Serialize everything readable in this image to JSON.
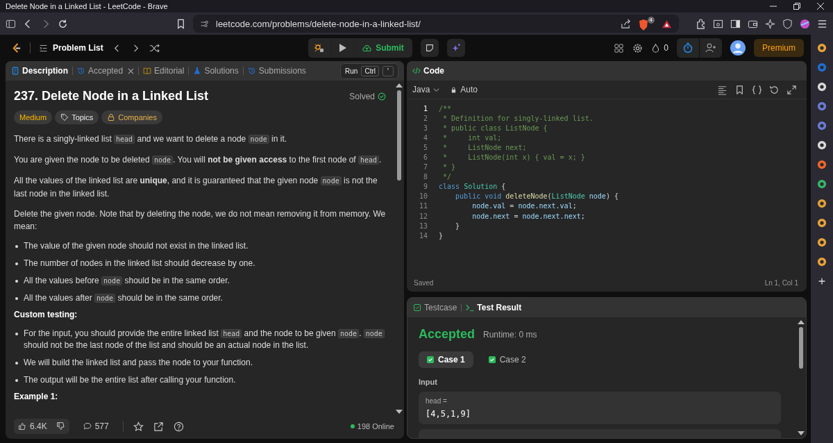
{
  "browser": {
    "title": "Delete Node in a Linked List - LeetCode - Brave",
    "url": "leetcode.com/problems/delete-node-in-a-linked-list/",
    "shields_count": "4"
  },
  "nav": {
    "problem_list": "Problem List",
    "submit": "Submit",
    "streak": "0",
    "premium": "Premium"
  },
  "run_hint": {
    "label": "Run",
    "keys": [
      "Ctrl",
      "'"
    ]
  },
  "description": {
    "tabs": [
      {
        "label": "Description",
        "kind": "description",
        "selected": true,
        "closable": false
      },
      {
        "label": "Accepted",
        "kind": "history",
        "selected": false,
        "closable": true
      },
      {
        "label": "Editorial",
        "kind": "book",
        "selected": false,
        "closable": false
      },
      {
        "label": "Solutions",
        "kind": "flask",
        "selected": false,
        "closable": false
      },
      {
        "label": "Submissions",
        "kind": "history",
        "selected": false,
        "closable": false
      }
    ],
    "title": "237. Delete Node in a Linked List",
    "status": "Solved",
    "tags": [
      {
        "label": "Medium",
        "kind": "difficulty"
      },
      {
        "label": "Topics",
        "kind": "topics"
      },
      {
        "label": "Companies",
        "kind": "companies"
      }
    ],
    "blocks": [
      {
        "kind": "paragraph",
        "parts": [
          {
            "text": "There is a singly-linked list "
          },
          {
            "code": "head"
          },
          {
            "text": " and we want to delete a node "
          },
          {
            "code": "node"
          },
          {
            "text": " in it."
          }
        ]
      },
      {
        "kind": "paragraph",
        "parts": [
          {
            "text": "You are given the node to be deleted "
          },
          {
            "code": "node"
          },
          {
            "text": ". You will **not be given access** to the first node of "
          },
          {
            "code": "head"
          },
          {
            "text": "."
          }
        ]
      },
      {
        "kind": "paragraph",
        "parts": [
          {
            "text": "All the values of the linked list are **unique**, and it is guaranteed that the given node "
          },
          {
            "code": "node"
          },
          {
            "text": " is not the last node in the linked list."
          }
        ]
      },
      {
        "kind": "paragraph",
        "parts": [
          {
            "text": "Delete the given node. Note that by deleting the node, we do not mean removing it from memory. We mean:"
          }
        ]
      },
      {
        "kind": "bullet",
        "parts": [
          {
            "text": "The value of the given node should not exist in the linked list."
          }
        ]
      },
      {
        "kind": "bullet",
        "parts": [
          {
            "text": "The number of nodes in the linked list should decrease by one."
          }
        ]
      },
      {
        "kind": "bullet",
        "parts": [
          {
            "text": "All the values before "
          },
          {
            "code": "node"
          },
          {
            "text": " should be in the same order."
          }
        ]
      },
      {
        "kind": "bullet",
        "parts": [
          {
            "text": "All the values after "
          },
          {
            "code": "node"
          },
          {
            "text": " should be in the same order."
          }
        ]
      },
      {
        "kind": "heading",
        "parts": [
          {
            "text": "Custom testing:"
          }
        ]
      },
      {
        "kind": "bullet",
        "parts": [
          {
            "text": "For the input, you should provide the entire linked list "
          },
          {
            "code": "head"
          },
          {
            "text": " and the node to be given "
          },
          {
            "code": "node"
          },
          {
            "text": ". "
          },
          {
            "code": "node"
          },
          {
            "text": " should not be the last node of the list and should be an actual node in the list."
          }
        ]
      },
      {
        "kind": "bullet",
        "parts": [
          {
            "text": "We will build the linked list and pass the node to your function."
          }
        ]
      },
      {
        "kind": "bullet",
        "parts": [
          {
            "text": "The output will be the entire list after calling your function."
          }
        ]
      },
      {
        "kind": "heading",
        "parts": [
          {
            "text": "Example 1:"
          }
        ]
      }
    ],
    "likes": "6.4K",
    "comments": "577",
    "online": "198 Online"
  },
  "code": {
    "title": "Code",
    "language": "Java",
    "mode": "Auto",
    "lines": [
      {
        "number": "1",
        "tokens": [
          {
            "kind": "comment",
            "text": "/**"
          }
        ]
      },
      {
        "number": "2",
        "tokens": [
          {
            "kind": "comment",
            "text": " * Definition for singly-linked list."
          }
        ]
      },
      {
        "number": "3",
        "tokens": [
          {
            "kind": "comment",
            "text": " * public class ListNode {"
          }
        ]
      },
      {
        "number": "4",
        "tokens": [
          {
            "kind": "comment",
            "text": " *     int val;"
          }
        ]
      },
      {
        "number": "5",
        "tokens": [
          {
            "kind": "comment",
            "text": " *     ListNode next;"
          }
        ]
      },
      {
        "number": "6",
        "tokens": [
          {
            "kind": "comment",
            "text": " *     ListNode(int x) { val = x; }"
          }
        ]
      },
      {
        "number": "7",
        "tokens": [
          {
            "kind": "comment",
            "text": " * }"
          }
        ]
      },
      {
        "number": "8",
        "tokens": [
          {
            "kind": "comment",
            "text": " */"
          }
        ]
      },
      {
        "number": "9",
        "tokens": [
          {
            "kind": "keyword",
            "text": "class"
          },
          {
            "kind": "type",
            "text": " Solution"
          },
          {
            "kind": "plain",
            "text": " {"
          }
        ]
      },
      {
        "number": "10",
        "tokens": [
          {
            "kind": "keyword",
            "text": "    public"
          },
          {
            "kind": "keyword",
            "text": " void"
          },
          {
            "kind": "function",
            "text": " deleteNode"
          },
          {
            "kind": "plain",
            "text": "("
          },
          {
            "kind": "type",
            "text": "ListNode"
          },
          {
            "kind": "variable",
            "text": " node"
          },
          {
            "kind": "plain",
            "text": ") {"
          }
        ]
      },
      {
        "number": "11",
        "tokens": [
          {
            "kind": "variable",
            "text": "        node.val"
          },
          {
            "kind": "plain",
            "text": " = "
          },
          {
            "kind": "variable",
            "text": "node.next.val"
          },
          {
            "kind": "plain",
            "text": ";"
          }
        ]
      },
      {
        "number": "12",
        "tokens": [
          {
            "kind": "variable",
            "text": "        node.next"
          },
          {
            "kind": "plain",
            "text": " = "
          },
          {
            "kind": "variable",
            "text": "node.next.next"
          },
          {
            "kind": "plain",
            "text": ";"
          }
        ]
      },
      {
        "number": "13",
        "tokens": [
          {
            "kind": "plain",
            "text": "    }"
          }
        ]
      },
      {
        "number": "14",
        "tokens": [
          {
            "kind": "plain",
            "text": "}"
          }
        ]
      }
    ],
    "saved": "Saved",
    "position": "Ln 1, Col 1"
  },
  "tests": {
    "tabs": [
      {
        "label": "Testcase",
        "kind": "testcase",
        "selected": false
      },
      {
        "label": "Test Result",
        "kind": "terminal",
        "selected": true
      }
    ],
    "verdict": "Accepted",
    "runtime": "Runtime: 0 ms",
    "cases": [
      {
        "label": "Case 1",
        "selected": true,
        "passed": true
      },
      {
        "label": "Case 2",
        "selected": false,
        "passed": true
      }
    ],
    "input_label": "Input",
    "inputs": [
      {
        "name": "head =",
        "value": "[4,5,1,9]"
      }
    ]
  }
}
